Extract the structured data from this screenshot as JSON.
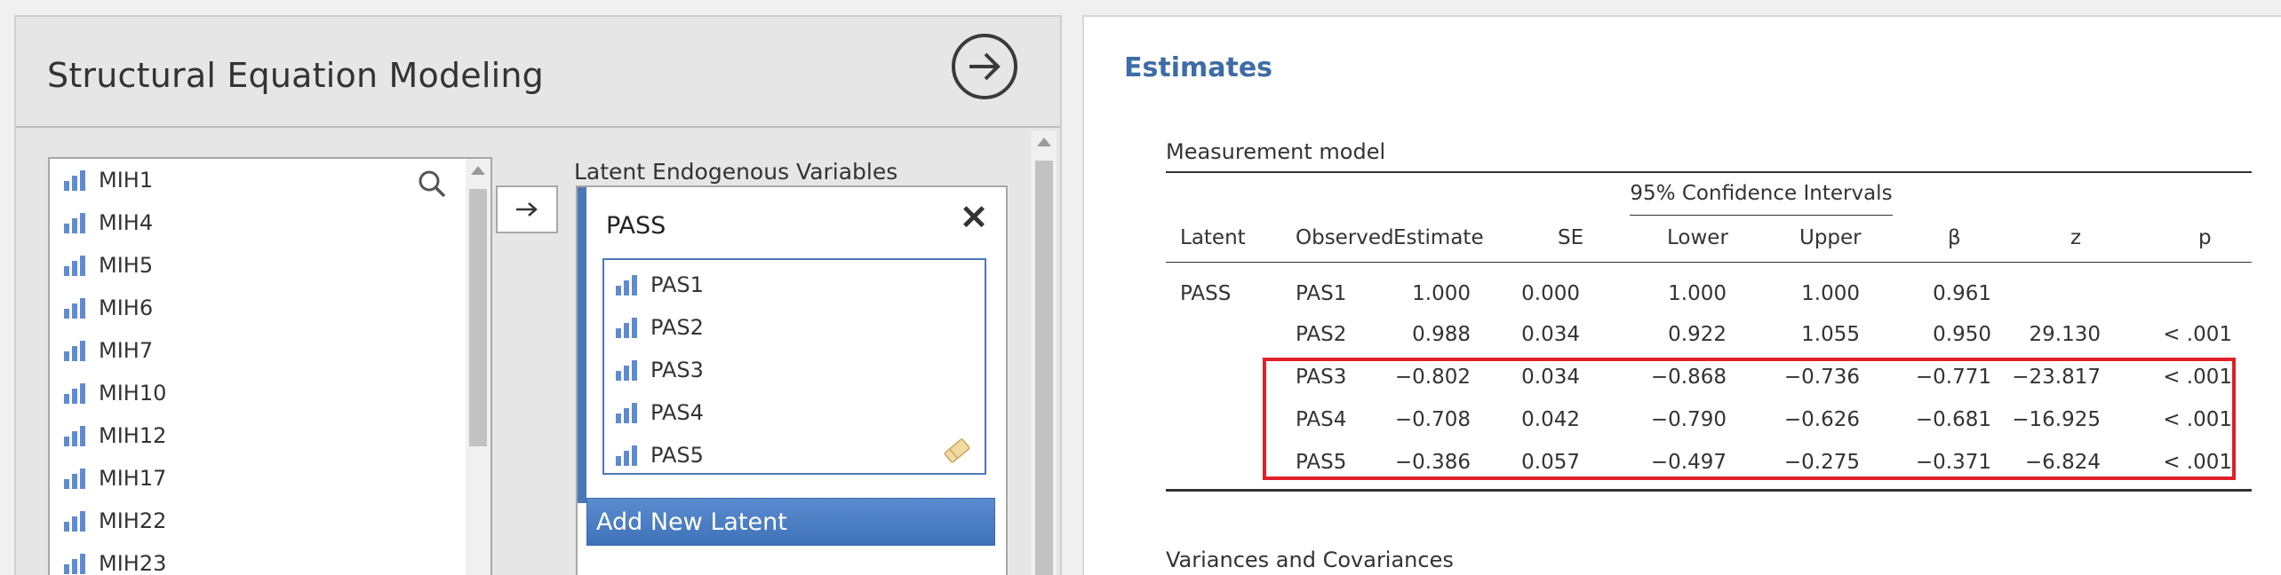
{
  "left": {
    "title": "Structural Equation Modeling",
    "source_variables": [
      "MIH1",
      "MIH4",
      "MIH5",
      "MIH6",
      "MIH7",
      "MIH10",
      "MIH12",
      "MIH17",
      "MIH22",
      "MIH23"
    ],
    "latent_section_label": "Latent Endogenous Variables",
    "latent": {
      "name": "PASS",
      "variables": [
        "PAS1",
        "PAS2",
        "PAS3",
        "PAS4",
        "PAS5"
      ]
    },
    "add_latent_label": "Add New Latent",
    "icons": {
      "go": "arrow-right-circle-icon",
      "search": "search-icon",
      "move": "arrow-right-icon",
      "close": "close-icon",
      "eraser": "eraser-icon",
      "variable": "continuous-variable-icon"
    },
    "accent_color": "#4a78b6"
  },
  "results": {
    "heading": "Estimates",
    "table_title": "Measurement model",
    "ci_header": "95% Confidence Intervals",
    "columns": [
      "Latent",
      "Observed",
      "Estimate",
      "SE",
      "Lower",
      "Upper",
      "β",
      "z",
      "p"
    ],
    "rows": [
      {
        "latent": "PASS",
        "observed": "PAS1",
        "estimate": "1.000",
        "se": "0.000",
        "lower": "1.000",
        "upper": "1.000",
        "beta": "0.961",
        "z": "",
        "p": ""
      },
      {
        "latent": "",
        "observed": "PAS2",
        "estimate": "0.988",
        "se": "0.034",
        "lower": "0.922",
        "upper": "1.055",
        "beta": "0.950",
        "z": "29.130",
        "p": "< .001"
      },
      {
        "latent": "",
        "observed": "PAS3",
        "estimate": "−0.802",
        "se": "0.034",
        "lower": "−0.868",
        "upper": "−0.736",
        "beta": "−0.771",
        "z": "−23.817",
        "p": "< .001"
      },
      {
        "latent": "",
        "observed": "PAS4",
        "estimate": "−0.708",
        "se": "0.042",
        "lower": "−0.790",
        "upper": "−0.626",
        "beta": "−0.681",
        "z": "−16.925",
        "p": "< .001"
      },
      {
        "latent": "",
        "observed": "PAS5",
        "estimate": "−0.386",
        "se": "0.057",
        "lower": "−0.497",
        "upper": "−0.275",
        "beta": "−0.371",
        "z": "−6.824",
        "p": "< .001"
      }
    ],
    "next_section": "Variances and Covariances",
    "heading_color": "#3e6ca5",
    "highlight_color": "#e0202a"
  }
}
